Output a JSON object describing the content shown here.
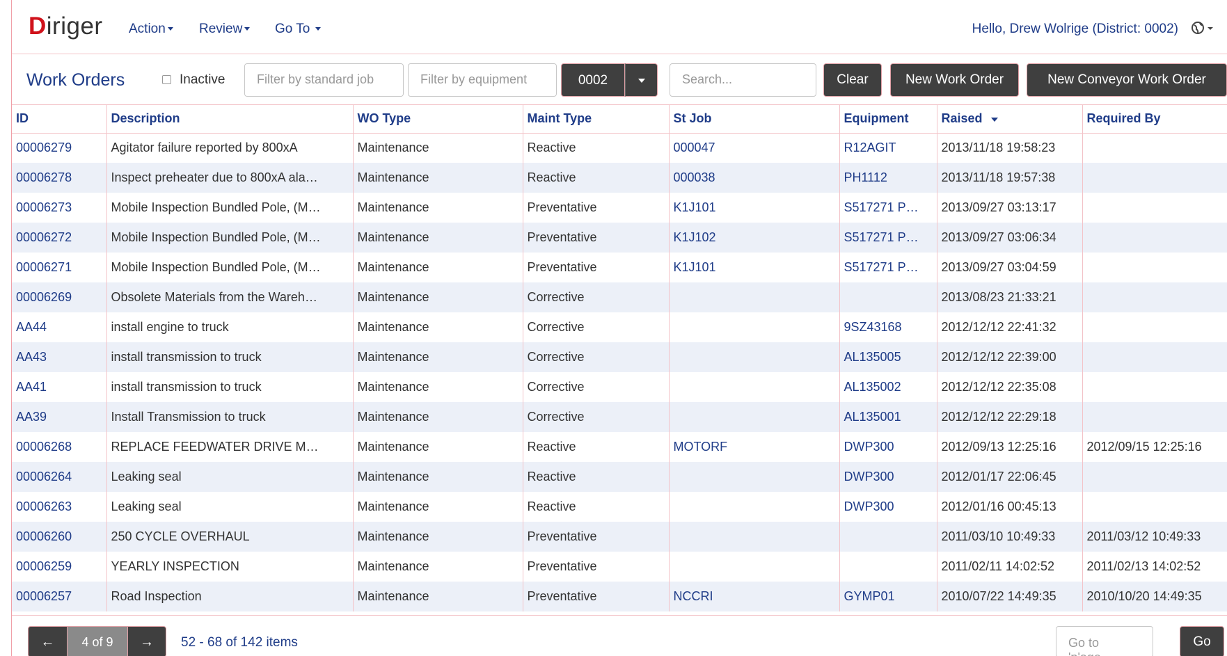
{
  "navbar": {
    "logo_mark": "D",
    "logo_rest": "iriger",
    "menus": [
      "Action",
      "Review",
      "Go To"
    ],
    "greeting": "Hello, Drew Wolrige (District: 0002)",
    "globe_icon": "globe-icon"
  },
  "toolbar": {
    "title": "Work Orders",
    "inactive_label": "Inactive",
    "filter_standard_job_placeholder": "Filter by standard job",
    "filter_equipment_placeholder": "Filter by equipment",
    "district_value": "0002",
    "search_placeholder": "Search...",
    "clear_label": "Clear",
    "new_work_order_label": "New Work Order",
    "new_conveyor_label": "New Conveyor Work Order"
  },
  "table": {
    "columns": [
      "ID",
      "Description",
      "WO Type",
      "Maint Type",
      "St Job",
      "Equipment",
      "Raised",
      "Required By"
    ],
    "sorted_column": "Raised",
    "rows": [
      {
        "id": "00006279",
        "desc": "Agitator failure reported by 800xA",
        "wo_type": "Maintenance",
        "maint": "Reactive",
        "st_job": "000047",
        "equip": "R12AGIT",
        "raised": "2013/11/18 19:58:23",
        "required": ""
      },
      {
        "id": "00006278",
        "desc": "Inspect preheater due to 800xA ala…",
        "wo_type": "Maintenance",
        "maint": "Reactive",
        "st_job": "000038",
        "equip": "PH1112",
        "raised": "2013/11/18 19:57:38",
        "required": ""
      },
      {
        "id": "00006273",
        "desc": "Mobile Inspection Bundled Pole, (M…",
        "wo_type": "Maintenance",
        "maint": "Preventative",
        "st_job": "K1J101",
        "equip": "S517271 P…",
        "raised": "2013/09/27 03:13:17",
        "required": ""
      },
      {
        "id": "00006272",
        "desc": "Mobile Inspection Bundled Pole, (M…",
        "wo_type": "Maintenance",
        "maint": "Preventative",
        "st_job": "K1J102",
        "equip": "S517271 P…",
        "raised": "2013/09/27 03:06:34",
        "required": ""
      },
      {
        "id": "00006271",
        "desc": "Mobile Inspection Bundled Pole, (M…",
        "wo_type": "Maintenance",
        "maint": "Preventative",
        "st_job": "K1J101",
        "equip": "S517271 P…",
        "raised": "2013/09/27 03:04:59",
        "required": ""
      },
      {
        "id": "00006269",
        "desc": "Obsolete Materials from the Wareh…",
        "wo_type": "Maintenance",
        "maint": "Corrective",
        "st_job": "",
        "equip": "",
        "raised": "2013/08/23 21:33:21",
        "required": ""
      },
      {
        "id": "AA44",
        "desc": "install engine to truck",
        "wo_type": "Maintenance",
        "maint": "Corrective",
        "st_job": "",
        "equip": "9SZ43168",
        "raised": "2012/12/12 22:41:32",
        "required": ""
      },
      {
        "id": "AA43",
        "desc": "install transmission to truck",
        "wo_type": "Maintenance",
        "maint": "Corrective",
        "st_job": "",
        "equip": "AL135005",
        "raised": "2012/12/12 22:39:00",
        "required": ""
      },
      {
        "id": "AA41",
        "desc": "install transmission to truck",
        "wo_type": "Maintenance",
        "maint": "Corrective",
        "st_job": "",
        "equip": "AL135002",
        "raised": "2012/12/12 22:35:08",
        "required": ""
      },
      {
        "id": "AA39",
        "desc": "Install Transmission to truck",
        "wo_type": "Maintenance",
        "maint": "Corrective",
        "st_job": "",
        "equip": "AL135001",
        "raised": "2012/12/12 22:29:18",
        "required": ""
      },
      {
        "id": "00006268",
        "desc": "REPLACE FEEDWATER DRIVE M…",
        "wo_type": "Maintenance",
        "maint": "Reactive",
        "st_job": "MOTORF",
        "equip": "DWP300",
        "raised": "2012/09/13 12:25:16",
        "required": "2012/09/15 12:25:16"
      },
      {
        "id": "00006264",
        "desc": "Leaking seal",
        "wo_type": "Maintenance",
        "maint": "Reactive",
        "st_job": "",
        "equip": "DWP300",
        "raised": "2012/01/17 22:06:45",
        "required": ""
      },
      {
        "id": "00006263",
        "desc": "Leaking seal",
        "wo_type": "Maintenance",
        "maint": "Reactive",
        "st_job": "",
        "equip": "DWP300",
        "raised": "2012/01/16 00:45:13",
        "required": ""
      },
      {
        "id": "00006260",
        "desc": "250 CYCLE OVERHAUL",
        "wo_type": "Maintenance",
        "maint": "Preventative",
        "st_job": "",
        "equip": "",
        "raised": "2011/03/10 10:49:33",
        "required": "2011/03/12 10:49:33"
      },
      {
        "id": "00006259",
        "desc": "YEARLY INSPECTION",
        "wo_type": "Maintenance",
        "maint": "Preventative",
        "st_job": "",
        "equip": "",
        "raised": "2011/02/11 14:02:52",
        "required": "2011/02/13 14:02:52"
      },
      {
        "id": "00006257",
        "desc": "Road Inspection",
        "wo_type": "Maintenance",
        "maint": "Preventative",
        "st_job": "NCCRI",
        "equip": "GYMP01",
        "raised": "2010/07/22 14:49:35",
        "required": "2010/10/20 14:49:35"
      }
    ]
  },
  "pager": {
    "prev_glyph": "←",
    "page_label": "4 of 9",
    "next_glyph": "→",
    "items_info": "52 - 68 of 142 items",
    "goto_placeholder": "Go to 'p'age...",
    "go_label": "Go"
  },
  "colors": {
    "brand_red": "#d0121b",
    "link_blue": "#1f3c88",
    "button_dark": "#3f3f3f",
    "row_alt": "#ecf0f8",
    "divider_pink": "#f3c3c8"
  }
}
